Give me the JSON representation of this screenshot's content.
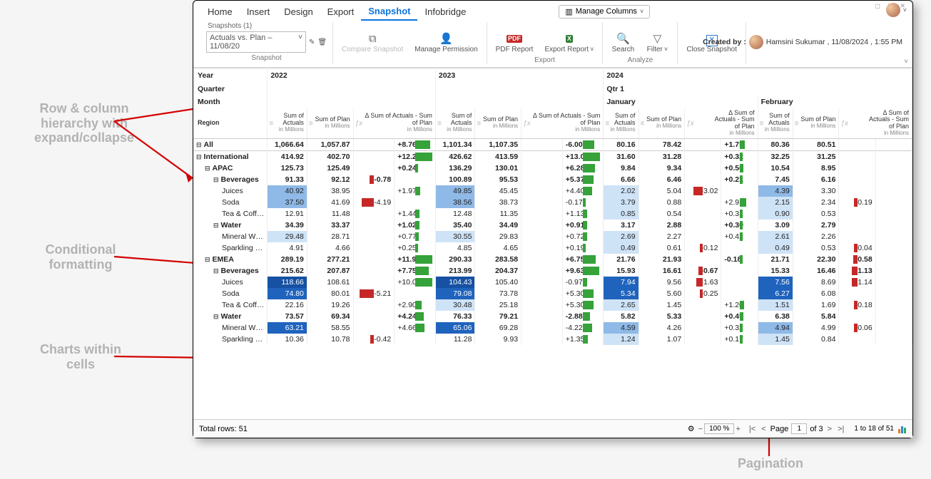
{
  "annotations": {
    "hierarchy": "Row & column\nhierarchy with\nexpand/collapse",
    "cond_fmt": "Conditional\nformatting",
    "charts_cells": "Charts within\ncells",
    "pagination": "Pagination"
  },
  "window_ctrls": "◻  ⧉  ✕",
  "menu": {
    "items": [
      "Home",
      "Insert",
      "Design",
      "Export",
      "Snapshot",
      "Infobridge"
    ],
    "active_index": 4,
    "manage_columns": "Manage Columns"
  },
  "ribbon": {
    "snapshot_count": "Snapshots (1)",
    "snapshot_name": "Actuals vs. Plan – 11/08/20",
    "groups": {
      "snapshot": "Snapshot",
      "export": "Export",
      "analyze": "Analyze"
    },
    "buttons": {
      "compare": "Compare\nSnapshot",
      "manage_perm": "Manage\nPermission",
      "pdf": "PDF\nReport",
      "excel": "Export\nReport",
      "search": "Search",
      "filter": "Filter",
      "close": "Close\nSnapshot"
    },
    "created_by_label": "Created by :",
    "created_by_name": "Hamsini Sukumar , 11/08/2024 , 1:55 PM"
  },
  "table": {
    "dim_labels": {
      "year": "Year",
      "quarter": "Quarter",
      "month": "Month",
      "region": "Region"
    },
    "years": [
      "2022",
      "2023",
      "2024"
    ],
    "qtr": "Qtr 1",
    "months": [
      "January",
      "February"
    ],
    "col_hdrs": {
      "actuals": "Sum of\nActuals",
      "plan": "Sum of Plan",
      "delta": "Δ Sum of Actuals - Sum\nof Plan",
      "delta_short": "Δ Sum of\nActuals - Sum\nof Plan",
      "unit": "in Millions"
    },
    "rows": [
      {
        "lvl": 0,
        "label": "All",
        "bold": true,
        "v": [
          "1,066.64",
          "1,057.87",
          "",
          "+8.76",
          "1,101.34",
          "1,107.35",
          "",
          "-6.00",
          "80.16",
          "78.42",
          "",
          "+1.75",
          "80.36",
          "80.51",
          ""
        ]
      },
      {
        "lvl": 0,
        "label": "International",
        "bold": true,
        "exp": "⊟",
        "v": [
          "414.92",
          "402.70",
          "",
          "+12.22",
          "426.62",
          "413.59",
          "",
          "+13.03",
          "31.60",
          "31.28",
          "",
          "+0.32",
          "32.25",
          "31.25",
          ""
        ]
      },
      {
        "lvl": 1,
        "label": "APAC",
        "exp": "⊟",
        "v": [
          "125.73",
          "125.49",
          "",
          "+0.24",
          "136.29",
          "130.01",
          "",
          "+6.28",
          "9.84",
          "9.34",
          "",
          "+0.50",
          "10.54",
          "8.95",
          ""
        ]
      },
      {
        "lvl": 2,
        "label": "Beverages",
        "exp": "⊟",
        "v": [
          "91.33",
          "92.12",
          "-0.78",
          "",
          "100.89",
          "95.53",
          "",
          "+5.37",
          "6.66",
          "6.46",
          "",
          "+0.21",
          "7.45",
          "6.16",
          ""
        ]
      },
      {
        "lvl": 3,
        "label": "Juices",
        "hl": {
          "0": "med",
          "4": "med",
          "8": "light",
          "12": "med"
        },
        "v": [
          "40.92",
          "38.95",
          "",
          "+1.97",
          "49.85",
          "45.45",
          "",
          "+4.40",
          "2.02",
          "5.04",
          "-3.02",
          "",
          "4.39",
          "3.30",
          ""
        ]
      },
      {
        "lvl": 3,
        "label": "Soda",
        "hl": {
          "0": "med",
          "4": "med",
          "8": "light",
          "12": "light"
        },
        "v": [
          "37.50",
          "41.69",
          "-4.19",
          "",
          "38.56",
          "38.73",
          "",
          "-0.17",
          "3.79",
          "0.88",
          "",
          "+2.91",
          "2.15",
          "2.34",
          "-0.19"
        ]
      },
      {
        "lvl": 3,
        "label": "Tea & Coff…",
        "hl": {
          "8": "light",
          "12": "light"
        },
        "v": [
          "12.91",
          "11.48",
          "",
          "+1.44",
          "12.48",
          "11.35",
          "",
          "+1.13",
          "0.85",
          "0.54",
          "",
          "+0.31",
          "0.90",
          "0.53",
          ""
        ]
      },
      {
        "lvl": 2,
        "label": "Water",
        "exp": "⊟",
        "v": [
          "34.39",
          "33.37",
          "",
          "+1.02",
          "35.40",
          "34.49",
          "",
          "+0.91",
          "3.17",
          "2.88",
          "",
          "+0.30",
          "3.09",
          "2.79",
          ""
        ]
      },
      {
        "lvl": 3,
        "label": "Mineral W…",
        "hl": {
          "0": "light",
          "4": "light",
          "8": "light",
          "12": "light"
        },
        "v": [
          "29.48",
          "28.71",
          "",
          "+0.77",
          "30.55",
          "29.83",
          "",
          "+0.72",
          "2.69",
          "2.27",
          "",
          "+0.42",
          "2.61",
          "2.26",
          ""
        ]
      },
      {
        "lvl": 3,
        "label": "Sparkling …",
        "hl": {
          "8": "light",
          "12": "light"
        },
        "v": [
          "4.91",
          "4.66",
          "",
          "+0.25",
          "4.85",
          "4.65",
          "",
          "+0.19",
          "0.49",
          "0.61",
          "-0.12",
          "",
          "0.49",
          "0.53",
          "-0.04"
        ]
      },
      {
        "lvl": 1,
        "label": "EMEA",
        "exp": "⊟",
        "v": [
          "289.19",
          "277.21",
          "",
          "+11.98",
          "290.33",
          "283.58",
          "",
          "+6.75",
          "21.76",
          "21.93",
          "",
          "-0.18",
          "21.71",
          "22.30",
          "-0.58"
        ]
      },
      {
        "lvl": 2,
        "label": "Beverages",
        "exp": "⊟",
        "v": [
          "215.62",
          "207.87",
          "",
          "+7.75",
          "213.99",
          "204.37",
          "",
          "+9.63",
          "15.93",
          "16.61",
          "-0.67",
          "",
          "15.33",
          "16.46",
          "-1.13"
        ]
      },
      {
        "lvl": 3,
        "label": "Juices",
        "hl": {
          "0": "dark",
          "4": "dark",
          "8": "dark2",
          "12": "dark2"
        },
        "v": [
          "118.66",
          "108.61",
          "",
          "+10.06",
          "104.43",
          "105.40",
          "",
          "-0.97",
          "7.94",
          "9.56",
          "-1.63",
          "",
          "7.56",
          "8.69",
          "-1.14"
        ]
      },
      {
        "lvl": 3,
        "label": "Soda",
        "hl": {
          "0": "dark2",
          "4": "dark2",
          "8": "dark2",
          "12": "dark2"
        },
        "v": [
          "74.80",
          "80.01",
          "-5.21",
          "",
          "79.08",
          "73.78",
          "",
          "+5.30",
          "5.34",
          "5.60",
          "-0.25",
          "",
          "6.27",
          "6.08",
          ""
        ]
      },
      {
        "lvl": 3,
        "label": "Tea & Coff…",
        "hl": {
          "4": "light",
          "8": "light",
          "12": "light"
        },
        "v": [
          "22.16",
          "19.26",
          "",
          "+2.90",
          "30.48",
          "25.18",
          "",
          "+5.30",
          "2.65",
          "1.45",
          "",
          "+1.20",
          "1.51",
          "1.69",
          "-0.18"
        ]
      },
      {
        "lvl": 2,
        "label": "Water",
        "exp": "⊟",
        "v": [
          "73.57",
          "69.34",
          "",
          "+4.24",
          "76.33",
          "79.21",
          "",
          "-2.88",
          "5.82",
          "5.33",
          "",
          "+0.49",
          "6.38",
          "5.84",
          ""
        ]
      },
      {
        "lvl": 3,
        "label": "Mineral W…",
        "hl": {
          "0": "dark2",
          "4": "dark2",
          "8": "med",
          "12": "med"
        },
        "v": [
          "63.21",
          "58.55",
          "",
          "+4.66",
          "65.06",
          "69.28",
          "",
          "-4.22",
          "4.59",
          "4.26",
          "",
          "+0.32",
          "4.94",
          "4.99",
          "-0.06"
        ]
      },
      {
        "lvl": 3,
        "label": "Sparkling …",
        "hl": {
          "8": "light",
          "12": "light"
        },
        "v": [
          "10.36",
          "10.78",
          "-0.42",
          "",
          "11.28",
          "9.93",
          "",
          "+1.35",
          "1.24",
          "1.07",
          "",
          "+0.17",
          "1.45",
          "0.84",
          ""
        ]
      }
    ]
  },
  "footer": {
    "total_rows_label": "Total rows:",
    "total_rows": "51",
    "zoom": "100 %",
    "page_label": "Page",
    "page_current": "1",
    "page_of": "of 3",
    "row_range": "1 to 18 of 51"
  }
}
